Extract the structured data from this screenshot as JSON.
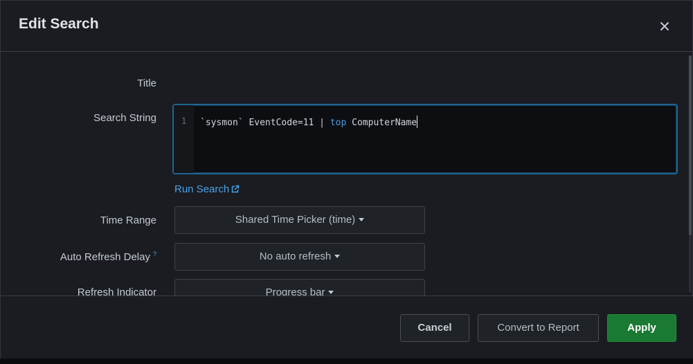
{
  "modal": {
    "title": "Edit Search",
    "close_icon": "close-icon"
  },
  "form": {
    "title_label": "Title",
    "search_string_label": "Search String",
    "editor": {
      "line_number": "1",
      "code_prefix": "`sysmon` EventCode=11 | ",
      "code_keyword": "top",
      "code_suffix": " ComputerName"
    },
    "run_search_label": "Run Search",
    "time_range_label": "Time Range",
    "time_range_value": "Shared Time Picker (time)",
    "auto_refresh_label": "Auto Refresh Delay",
    "auto_refresh_help": "?",
    "auto_refresh_value": "No auto refresh",
    "refresh_indicator_label": "Refresh Indicator",
    "refresh_indicator_value": "Progress bar"
  },
  "footer": {
    "cancel_label": "Cancel",
    "convert_label": "Convert to Report",
    "apply_label": "Apply"
  },
  "colors": {
    "accent_link": "#4aa3e8",
    "apply_green": "#1a7a33",
    "editor_focus": "#1e6592"
  }
}
